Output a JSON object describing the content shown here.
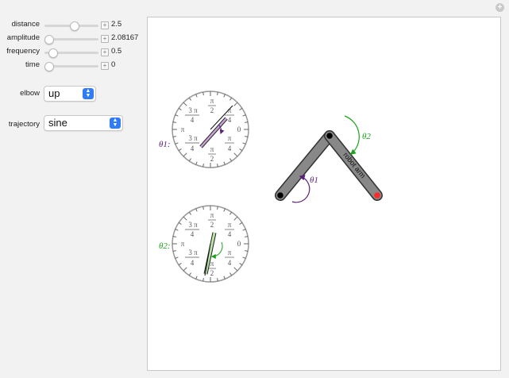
{
  "controls": {
    "sliders": [
      {
        "label": "distance",
        "value": "2.5",
        "fraction": 0.55
      },
      {
        "label": "amplitude",
        "value": "2.08167",
        "fraction": 0.0
      },
      {
        "label": "frequency",
        "value": "0.5",
        "fraction": 0.08
      },
      {
        "label": "time",
        "value": "0",
        "fraction": 0.0
      }
    ],
    "elbow": {
      "label": "elbow",
      "selected": "up"
    },
    "trajectory": {
      "label": "trajectory",
      "selected": "sine"
    }
  },
  "plot": {
    "dial1_label": "θ1:",
    "dial2_label": "θ2:",
    "dial_ticks": {
      "top_num": "π",
      "top_den": "2",
      "right": "0",
      "left": "π",
      "ur_num": "π",
      "ur_den": "4",
      "ul_num": "3 π",
      "ul_den": "4",
      "lr_num": "π",
      "lr_den": "4",
      "ll_num": "3 π",
      "ll_den": "4",
      "bottom_num": "π",
      "bottom_den": "2"
    },
    "arm_label": "robot arm",
    "theta1_label": "θ1",
    "theta2_label": "θ2",
    "colors": {
      "theta1": "#5b1e7a",
      "theta2": "#1aa31a",
      "end_effector": "#ff2a2a",
      "dial1_needle": "#c9a3d6",
      "dial2_needle": "#b9e6a8"
    }
  }
}
